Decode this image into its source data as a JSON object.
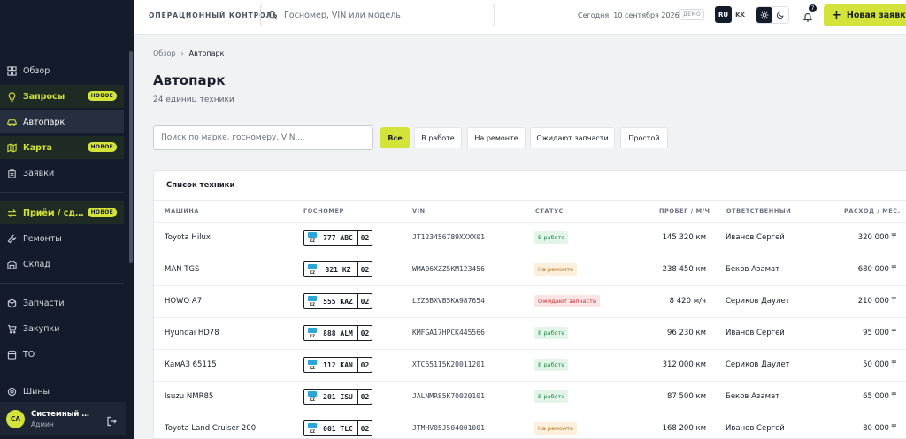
{
  "sidebar": {
    "items": [
      {
        "label": "Обзор",
        "icon": "grid-icon"
      },
      {
        "label": "Запросы",
        "icon": "lightbulb-icon",
        "badge": "НОВОЕ"
      },
      {
        "label": "Автопарк",
        "icon": "car-icon"
      },
      {
        "label": "Карта",
        "icon": "map-icon",
        "badge": "НОВОЕ"
      },
      {
        "label": "Заявки",
        "icon": "clipboard-icon"
      },
      {
        "label": "Приём / сдача",
        "icon": "swap-icon",
        "badge": "НОВОЕ"
      },
      {
        "label": "Ремонты",
        "icon": "wrench-icon"
      },
      {
        "label": "Склад",
        "icon": "warehouse-icon"
      },
      {
        "label": "Запчасти",
        "icon": "package-icon"
      },
      {
        "label": "Закупки",
        "icon": "cart-icon"
      },
      {
        "label": "ТО",
        "icon": "calendar-icon"
      },
      {
        "label": "Шины",
        "icon": "tire-icon"
      }
    ],
    "user": {
      "initials": "СА",
      "name": "Системный Администратор",
      "role": "Админ"
    }
  },
  "topbar": {
    "title": "ОПЕРАЦИОННЫЙ КОНТРОЛЬ",
    "search_placeholder": "Госномер, VIN или модель",
    "date": "Сегодня, 10 сентября 2026",
    "demo": "ДЕМО",
    "lang_ru": "RU",
    "lang_kk": "KK",
    "notifications": "7",
    "new_request": "Новая заявка"
  },
  "breadcrumb": {
    "root": "Обзор",
    "current": "Автопарк"
  },
  "page": {
    "title": "Автопарк",
    "subtitle": "24 единиц техники"
  },
  "filters": {
    "search_placeholder": "Поиск по марке, госномеру, VIN...",
    "chips": [
      "Все",
      "В работе",
      "На ремонте",
      "Ожидают запчасти",
      "Простой"
    ],
    "active": "Все"
  },
  "table": {
    "title": "Список техники",
    "columns": [
      "МАШИНА",
      "ГОСНОМЕР",
      "VIN",
      "СТАТУС",
      "ПРОБЕГ / М/Ч",
      "ОТВЕТСТВЕННЫЙ",
      "РАСХОД / МЕС."
    ],
    "rows": [
      {
        "machine": "Toyota Hilux",
        "plate": "777 ABC",
        "region": "02",
        "flag": "KZ",
        "vin": "JT123456789XXXX01",
        "status": "В работе",
        "mileage": "145 320 км",
        "owner": "Иванов Сергей",
        "cost": "320 000 ₸"
      },
      {
        "machine": "MAN TGS",
        "plate": "321 KZ",
        "region": "02",
        "flag": "KZ",
        "vin": "WMA06XZZ5KM123456",
        "status": "На ремонте",
        "mileage": "238 450 км",
        "owner": "Беков Азамат",
        "cost": "680 000 ₸"
      },
      {
        "machine": "HOWO A7",
        "plate": "555 KAZ",
        "region": "02",
        "flag": "KZ",
        "vin": "LZZ5BXVB5KA987654",
        "status": "Ожидают запчасти",
        "mileage": "8 420 м/ч",
        "owner": "Сериков Даулет",
        "cost": "210 000 ₸"
      },
      {
        "machine": "Hyundai HD78",
        "plate": "888 ALM",
        "region": "02",
        "flag": "KZ",
        "vin": "KMFGA17HPCK445566",
        "status": "В работе",
        "mileage": "96 230 км",
        "owner": "Иванов Сергей",
        "cost": "95 000 ₸"
      },
      {
        "machine": "КамАЗ 65115",
        "plate": "112 KAN",
        "region": "02",
        "flag": "KZ",
        "vin": "XTC65115K20011201",
        "status": "В работе",
        "mileage": "312 000 км",
        "owner": "Сериков Даулет",
        "cost": "50 000 ₸"
      },
      {
        "machine": "Isuzu NMR85",
        "plate": "201 ISU",
        "region": "02",
        "flag": "KZ",
        "vin": "JALNMR85K70020101",
        "status": "В работе",
        "mileage": "87 500 км",
        "owner": "Беков Азамат",
        "cost": "65 000 ₸"
      },
      {
        "machine": "Toyota Land Cruiser 200",
        "plate": "001 TLC",
        "region": "02",
        "flag": "KZ",
        "vin": "JTMHV05J504001001",
        "status": "На ремонте",
        "mileage": "168 200 км",
        "owner": "Иванов Сергей",
        "cost": "80 000 ₸"
      }
    ]
  },
  "colors": {
    "accent": "#d4e33a",
    "sidebar": "#141c2b",
    "status_work": "#1f8a48",
    "status_repair": "#b06a10",
    "status_parts": "#c43434"
  }
}
